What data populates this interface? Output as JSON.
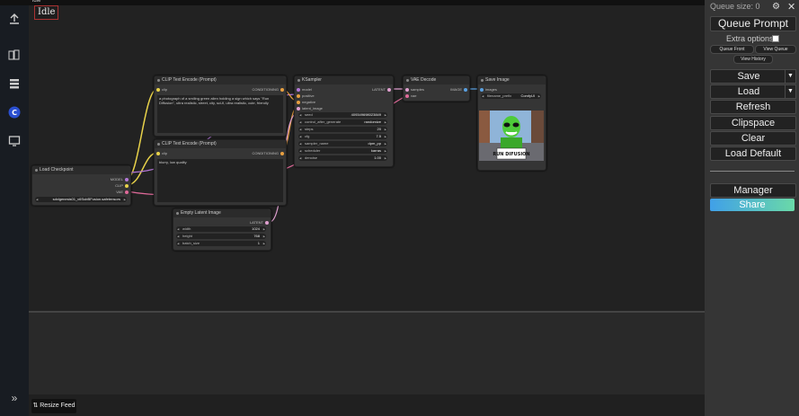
{
  "window": {
    "title": "idle"
  },
  "status": {
    "idle_label": "Idle"
  },
  "menu": {
    "queue_size": "Queue size: 0",
    "queue_prompt": "Queue Prompt",
    "extra_options": "Extra options",
    "queue_front": "Queue Front",
    "view_queue": "View Queue",
    "view_history": "View History",
    "save": "Save",
    "load": "Load",
    "refresh": "Refresh",
    "clipspace": "Clipspace",
    "clear": "Clear",
    "load_default": "Load Default",
    "manager": "Manager",
    "share": "Share"
  },
  "feed": {
    "resize_label": "Resize Feed"
  },
  "nodes": {
    "clip_pos": {
      "title": "CLIP Text Encode (Prompt)",
      "input": "clip",
      "output": "CONDITIONING",
      "text": "a photograph of a smiling green alien holding a sign which says \"Run Diffusion\", ultra realistic, street, city, sci-fi, ultra realistic, cute, friendly"
    },
    "clip_neg": {
      "title": "CLIP Text Encode (Prompt)",
      "input": "clip",
      "output": "CONDITIONING",
      "text": "blurry, low quality"
    },
    "checkpoint": {
      "title": "Load Checkpoint",
      "out_model": "MODEL",
      "out_clip": "CLIP",
      "out_vae": "VAE",
      "ckpt_name": "sdxlgenesis01_v6SubBFusion.safetensors"
    },
    "latent": {
      "title": "Empty Latent Image",
      "output": "LATENT",
      "width_label": "width",
      "width": "1024",
      "height_label": "height",
      "height": "768",
      "batch_label": "batch_size",
      "batch": "1"
    },
    "ksampler": {
      "title": "KSampler",
      "in_model": "model",
      "in_positive": "positive",
      "in_negative": "negative",
      "in_latent": "latent_image",
      "output": "LATENT",
      "seed_label": "seed",
      "seed": "409349698023849",
      "control_label": "control_after_generate",
      "control": "randomize",
      "steps_label": "steps",
      "steps": "20",
      "cfg_label": "cfg",
      "cfg": "7.5",
      "sampler_label": "sampler_name",
      "sampler": "dpm_pp",
      "scheduler_label": "scheduler",
      "scheduler": "karras",
      "denoise_label": "denoise",
      "denoise": "1.00"
    },
    "vae_decode": {
      "title": "VAE Decode",
      "in_samples": "samples",
      "in_vae": "vae",
      "output": "IMAGE"
    },
    "save_image": {
      "title": "Save Image",
      "input": "images",
      "prefix_label": "filename_prefix",
      "prefix": "ComfyUI"
    }
  },
  "sign_text": "RUN DIFUSION",
  "colors": {
    "accent_yellow": "#e8d24a",
    "accent_pink": "#e06a9a",
    "accent_purple": "#b478d8",
    "accent_blue": "#5aa0e0",
    "share_start": "#40a0e8",
    "share_end": "#6ad9a8"
  }
}
